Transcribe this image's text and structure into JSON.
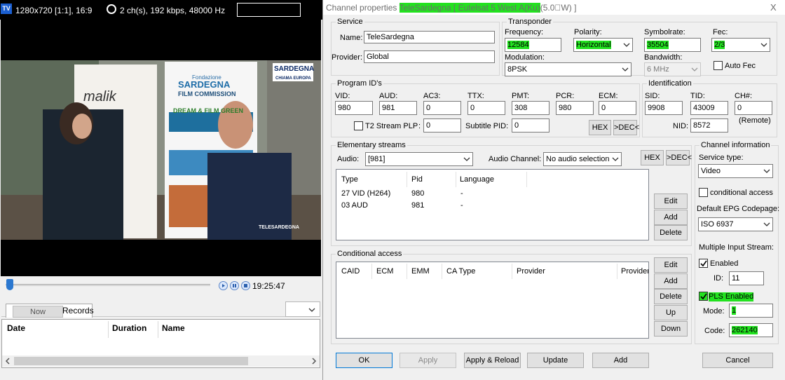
{
  "player": {
    "app_badge": "TV",
    "info_resolution": "1280x720 [1:1], 16:9",
    "info_audio": "2 ch(s), 192 kbps, 48000 Hz",
    "banner_top": "Fondazione",
    "banner_title": "SARDEGNA",
    "banner_sub": "FILM COMMISSION",
    "banner_tagline": "DREAM & FILM GREEN",
    "banner_left": "malik",
    "channel_logo_top": "SARDEGNA",
    "channel_logo_bottom": "CHIAMA EUROPA",
    "watermark": "TELESARDEGNA",
    "time": "19:25:47",
    "seek_fraction": 0.02
  },
  "epg": {
    "tab_now": "Now",
    "tab_records": "Records",
    "columns": [
      "Date",
      "Duration",
      "Name"
    ]
  },
  "dialog": {
    "title_prefix": "Channel properties ",
    "title_highlight": "TeleSardegna [ Eutelsat 5 West A(Ku)",
    "title_suffix": "(5.0\u0000W) ]",
    "close_glyph": "X",
    "service": {
      "group": "Service",
      "name_label": "Name:",
      "name_value": "TeleSardegna",
      "provider_label": "Provider:",
      "provider_value": "Global"
    },
    "transponder": {
      "group": "Transponder",
      "frequency_label": "Frequency:",
      "frequency_value": "12584",
      "polarity_label": "Polarity:",
      "polarity_value": "Horizontal",
      "symbolrate_label": "Symbolrate:",
      "symbolrate_value": "35504",
      "fec_label": "Fec:",
      "fec_value": "2/3",
      "modulation_label": "Modulation:",
      "modulation_value": "8PSK",
      "bandwidth_label": "Bandwidth:",
      "bandwidth_value": "6 MHz",
      "autofec_label": "Auto Fec"
    },
    "pids": {
      "group": "Program ID's",
      "vid_label": "VID:",
      "vid_value": "980",
      "aud_label": "AUD:",
      "aud_value": "981",
      "ac3_label": "AC3:",
      "ac3_value": "0",
      "ttx_label": "TTX:",
      "ttx_value": "0",
      "pmt_label": "PMT:",
      "pmt_value": "308",
      "pcr_label": "PCR:",
      "pcr_value": "980",
      "ecm_label": "ECM:",
      "ecm_value": "0",
      "t2_label": "T2 Stream PLP",
      "t2_colon": ":",
      "t2_value": "0",
      "subtitle_label": "Subtitle PID:",
      "subtitle_value": "0",
      "hex_label": "HEX",
      "dec_label": ">DEC<"
    },
    "identification": {
      "group": "Identification",
      "sid_label": "SID:",
      "sid_value": "9908",
      "tid_label": "TID:",
      "tid_value": "43009",
      "ch_label": "CH#:",
      "ch_value": "0",
      "nid_label": "NID:",
      "nid_value": "8572",
      "remote_label": "(Remote)"
    },
    "streams": {
      "group": "Elementary streams",
      "audio_label": "Audio:",
      "audio_value": "[981]",
      "audio_channel_label": "Audio Channel:",
      "audio_channel_value": "No audio selection",
      "hex_label": "HEX",
      "dec_label": ">DEC<",
      "columns": [
        "Type",
        "Pid",
        "Language"
      ],
      "rows": [
        {
          "type": "27 VID (H264)",
          "pid": "980",
          "lang": "-"
        },
        {
          "type": "03 AUD",
          "pid": "981",
          "lang": "-"
        }
      ],
      "edit_label": "Edit",
      "add_label": "Add",
      "delete_label": "Delete"
    },
    "conditional": {
      "group": "Conditional access",
      "columns": [
        "CAID",
        "ECM",
        "EMM",
        "CA Type",
        "Provider",
        "Provider"
      ],
      "edit_label": "Edit",
      "add_label": "Add",
      "delete_label": "Delete",
      "up_label": "Up",
      "down_label": "Down"
    },
    "channel_info": {
      "group": "Channel information",
      "service_type_label": "Service type:",
      "service_type_value": "Video",
      "conditional_label": "conditional access",
      "epg_label": "Default EPG Codepage:",
      "epg_value": "ISO 6937",
      "mis_label": "Multiple Input Stream:",
      "enabled_label": "Enabled",
      "id_label": "ID:",
      "id_value": "11",
      "pls_label": "PLS Enabled",
      "mode_label": "Mode:",
      "mode_value": "1",
      "code_label": "Code:",
      "code_value": "262140"
    },
    "buttons": {
      "ok": "OK",
      "apply": "Apply",
      "apply_reload": "Apply & Reload",
      "update": "Update",
      "add": "Add",
      "cancel": "Cancel"
    }
  }
}
